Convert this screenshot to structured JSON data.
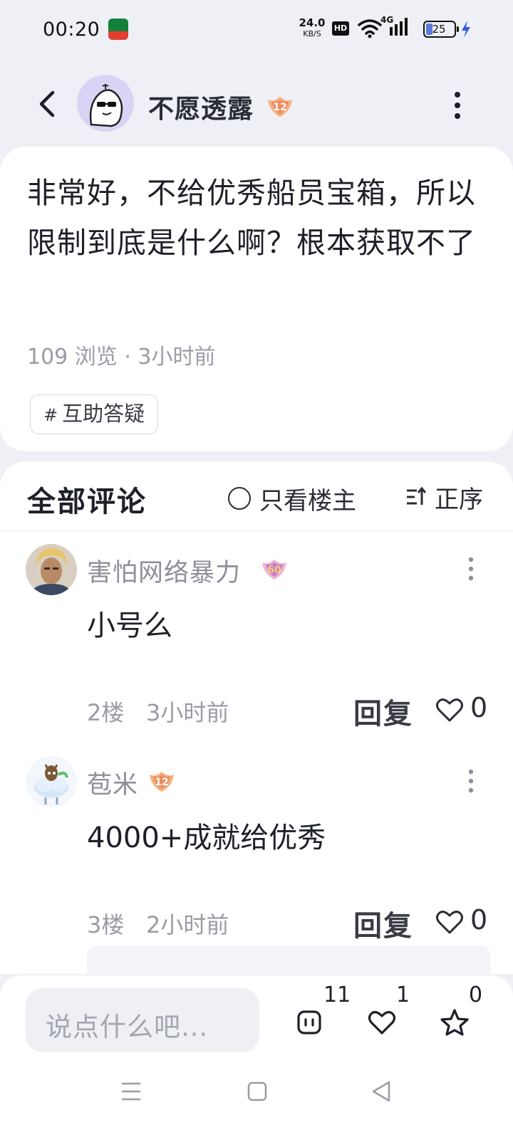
{
  "status_bar": {
    "time": "00:20",
    "net_speed": "24.0",
    "net_unit": "KB/S",
    "hd": "HD",
    "network": "4G",
    "battery": "25",
    "icons": [
      "app-icon",
      "wifi-icon",
      "signal-icon",
      "battery-icon",
      "charging-icon"
    ]
  },
  "header": {
    "author": "不愿透露",
    "author_level": "12",
    "icons": [
      "back-icon",
      "more-icon"
    ]
  },
  "post": {
    "title": "非常好，不给优秀船员宝箱，所以限制到底是什么啊？根本获取不了",
    "meta": "109 浏览 · 3小时前",
    "tag": "互助答疑",
    "tag_prefix": "#"
  },
  "comments_section": {
    "title": "全部评论",
    "op_only_label": "只看楼主",
    "sort_label": "正序"
  },
  "comments": [
    {
      "name": "害怕网络暴力",
      "level": "60",
      "text": "小号么",
      "floor": "2楼",
      "time": "3小时前",
      "reply_label": "回复",
      "likes": "0"
    },
    {
      "name": "苞米",
      "level": "12",
      "text": "4000+成就给优秀",
      "floor": "3楼",
      "time": "2小时前",
      "reply_label": "回复",
      "likes": "0"
    }
  ],
  "bottom_bar": {
    "input_placeholder": "说点什么吧...",
    "comment_count": "11",
    "like_count": "1",
    "favorite_count": "0"
  },
  "colors": {
    "page_bg": "#eef0f5",
    "card_bg": "#ffffff",
    "accent_purple": "#d9d3f5",
    "level_badge_orange": "#f29b5b",
    "level_badge_pink": "#e77ab0"
  }
}
